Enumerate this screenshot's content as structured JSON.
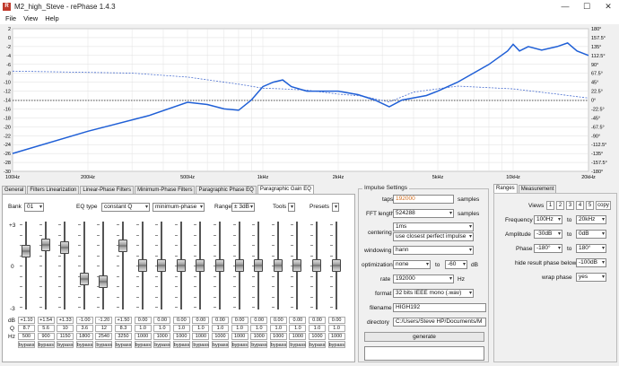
{
  "window": {
    "title": "M2_high_Steve  - rePhase 1.4.3",
    "min": "—",
    "max": "☐",
    "close": "✕"
  },
  "menu": [
    "File",
    "View",
    "Help"
  ],
  "plot": {
    "left_axis": [
      "2",
      "0",
      "-2",
      "-4",
      "-6",
      "-8",
      "-10",
      "-12",
      "-14",
      "-16",
      "-18",
      "-20",
      "-22",
      "-24",
      "-26",
      "-28",
      "-30"
    ],
    "right_axis": [
      "180°",
      "157.5°",
      "135°",
      "112.5°",
      "90°",
      "67.5°",
      "45°",
      "22.5°",
      "0°",
      "-22.5°",
      "-45°",
      "-67.5°",
      "-90°",
      "-112.5°",
      "-135°",
      "-157.5°",
      "-180°"
    ],
    "x_ticks": [
      "100Hz",
      "200Hz",
      "500Hz",
      "1kHz",
      "2kHz",
      "5kHz",
      "10kHz",
      "20kHz"
    ]
  },
  "eq": {
    "tabs": [
      "General",
      "Filters Linearization",
      "Linear-Phase Filters",
      "Minimum-Phase Filters",
      "Paragraphic Phase EQ",
      "Paragraphic Gain EQ"
    ],
    "bank_label": "Bank",
    "bank_value": "01",
    "eqtype_label": "EQ type",
    "eqtype_value": "constant Q",
    "phase_value": "minimum-phase",
    "range_label": "Range",
    "range_value": "± 3dB",
    "tools_label": "Tools",
    "presets_label": "Presets",
    "scale": [
      "+3",
      "0",
      "-3"
    ],
    "row_labels": [
      "dB",
      "Q",
      "Hz"
    ],
    "bypass_label": "bypass",
    "db": [
      "+1.10",
      "+1.54",
      "+1.33",
      "-1.00",
      "-1.20",
      "+1.50",
      "0.00",
      "0.00",
      "0.00",
      "0.00",
      "0.00",
      "0.00",
      "0.00",
      "0.00",
      "0.00",
      "0.00",
      "0.00"
    ],
    "q": [
      "8.7",
      "5.6",
      "10",
      "3.6",
      "12",
      "8.3",
      "1.0",
      "1.0",
      "1.0",
      "1.0",
      "1.0",
      "1.0",
      "1.0",
      "1.0",
      "1.0",
      "1.0",
      "1.0"
    ],
    "hz": [
      "500",
      "900",
      "1150",
      "1800",
      "2540",
      "3250",
      "1000",
      "1000",
      "1000",
      "1000",
      "1000",
      "1000",
      "1000",
      "1000",
      "1000",
      "1000",
      "1000"
    ]
  },
  "impulse": {
    "title": "Impulse Settings",
    "taps_label": "taps",
    "taps_value": "192000",
    "taps_unit": "samples",
    "fft_label": "FFT length",
    "fft_value": "524288",
    "fft_unit": "samples",
    "centering_label": "centering",
    "centering_value1": "1ms",
    "centering_value2": "use closest perfect impulse",
    "windowing_label": "windowing",
    "windowing_value": "hann",
    "opt_label": "optimization",
    "opt_value": "none",
    "opt_to": "to",
    "opt_db": "-60",
    "opt_unit": "dB",
    "rate_label": "rate",
    "rate_value": "192000",
    "rate_unit": "Hz",
    "format_label": "format",
    "format_value": "32 bits IEEE mono (.wav)",
    "filename_label": "filename",
    "filename_value": "HIGH192",
    "directory_label": "directory",
    "directory_value": "C:/Users/Steve HP/Documents/M",
    "generate_label": "generate"
  },
  "ranges": {
    "tabs": [
      "Ranges",
      "Measurement"
    ],
    "views_label": "Views",
    "views": [
      "1",
      "2",
      "3",
      "4",
      "5"
    ],
    "copy_label": "copy",
    "freq_label": "Frequency",
    "freq_from": "100Hz",
    "freq_to": "20kHz",
    "amp_label": "Amplitude",
    "amp_from": "-30dB",
    "amp_to": "0dB",
    "phase_label": "Phase",
    "phase_from": "-180°",
    "phase_to": "180°",
    "to_label": "to",
    "hide_label": "hide result phase below",
    "hide_value": "-100dB",
    "wrap_label": "wrap phase",
    "wrap_value": "yes"
  }
}
